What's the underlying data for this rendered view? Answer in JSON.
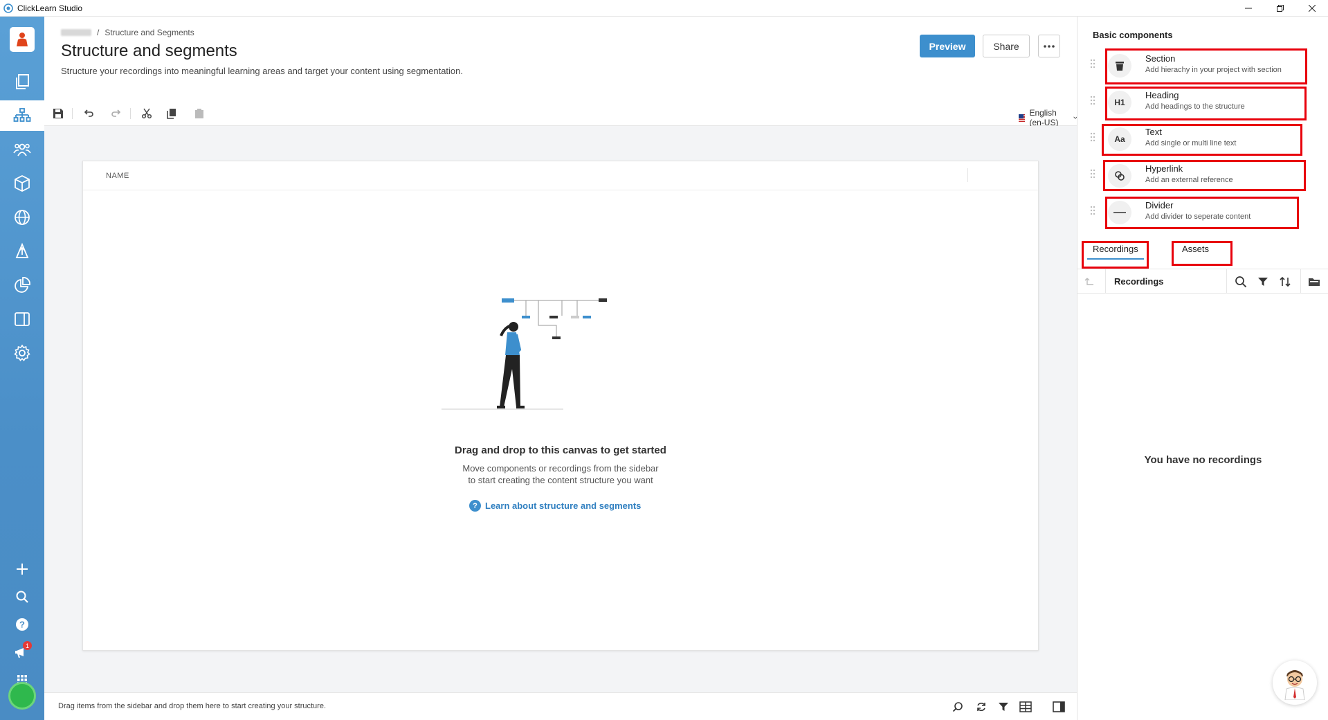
{
  "window": {
    "title": "ClickLearn Studio"
  },
  "header": {
    "breadcrumb_current": "Structure and Segments",
    "title": "Structure and segments",
    "subtitle": "Structure your recordings into meaningful learning areas and target your content using segmentation.",
    "preview_label": "Preview",
    "share_label": "Share"
  },
  "toolbar": {
    "language": "English (en-US)"
  },
  "canvas": {
    "column_name": "NAME",
    "empty_title": "Drag and drop to this canvas to get started",
    "empty_desc_line1": "Move components or recordings from the sidebar",
    "empty_desc_line2": "to start creating the content structure you want",
    "learn_link": "Learn about structure and segments"
  },
  "status": {
    "hint": "Drag items from the sidebar and drop them here to start creating your structure."
  },
  "nav": {
    "notification_count": "1"
  },
  "sidebar": {
    "title": "Basic components",
    "components": [
      {
        "name": "Section",
        "desc": "Add hierachy in your project with section",
        "icon": "section-icon"
      },
      {
        "name": "Heading",
        "desc": "Add headings to the structure",
        "icon": "H1"
      },
      {
        "name": "Text",
        "desc": "Add single or multi line text",
        "icon": "Aa"
      },
      {
        "name": "Hyperlink",
        "desc": "Add an external reference",
        "icon": "link-icon"
      },
      {
        "name": "Divider",
        "desc": "Add divider to seperate content",
        "icon": "divider-icon"
      }
    ],
    "tabs": [
      "Recordings",
      "Assets"
    ],
    "folder_label": "Recordings",
    "empty_text": "You have no recordings"
  },
  "colors": {
    "accent": "#3d8fcd",
    "nav_bg": "#4b8fc8",
    "highlight_box": "#e8000b"
  }
}
